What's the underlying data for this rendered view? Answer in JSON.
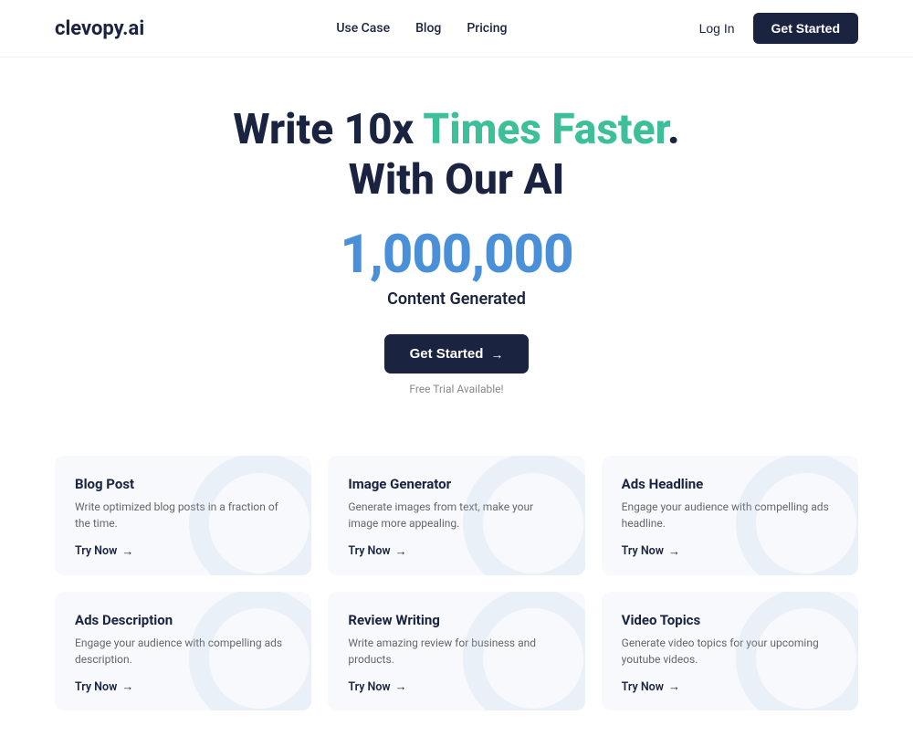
{
  "nav": {
    "logo": "clevopy.ai",
    "links": [
      {
        "label": "Use Case"
      },
      {
        "label": "Blog"
      },
      {
        "label": "Pricing"
      }
    ],
    "login_label": "Log In",
    "started_label": "Get Started"
  },
  "hero": {
    "headline_part1": "Write 10x ",
    "headline_highlight": "Times Faster",
    "headline_part2": ".",
    "headline_line2": "With Our AI",
    "stat": "1,000,000",
    "sub": "Content Generated",
    "cta_label": "Get Started",
    "free_trial": "Free Trial Available!"
  },
  "cards": [
    {
      "title": "Blog Post",
      "desc": "Write optimized blog posts in a fraction of the time.",
      "link": "Try Now"
    },
    {
      "title": "Image Generator",
      "desc": "Generate images from text, make your image more appealing.",
      "link": "Try Now"
    },
    {
      "title": "Ads Headline",
      "desc": "Engage your audience with compelling ads headline.",
      "link": "Try Now"
    },
    {
      "title": "Ads Description",
      "desc": "Engage your audience with compelling ads description.",
      "link": "Try Now"
    },
    {
      "title": "Review Writing",
      "desc": "Write amazing review for business and products.",
      "link": "Try Now"
    },
    {
      "title": "Video Topics",
      "desc": "Generate video topics for your upcoming youtube videos.",
      "link": "Try Now"
    }
  ]
}
